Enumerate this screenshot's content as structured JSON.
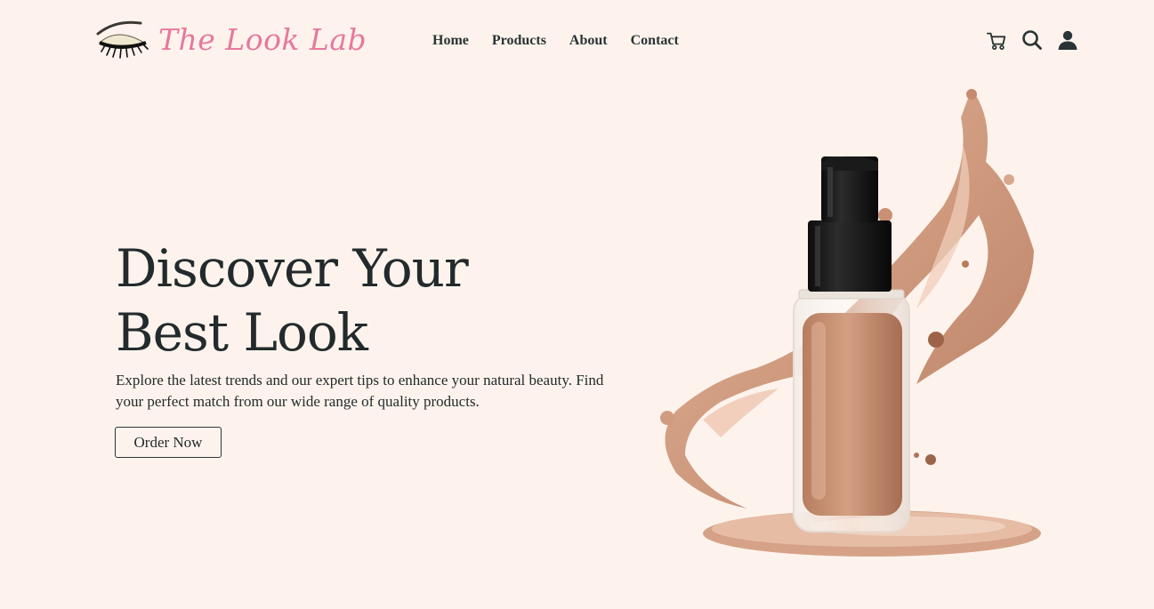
{
  "brand": {
    "name": "The Look Lab",
    "logo_icon": "eye-lashes-icon",
    "accent_color": "#e8779e"
  },
  "nav": {
    "items": [
      {
        "label": "Home"
      },
      {
        "label": "Products"
      },
      {
        "label": "About"
      },
      {
        "label": "Contact"
      }
    ]
  },
  "header_icons": [
    "cart-icon",
    "search-icon",
    "user-icon"
  ],
  "hero": {
    "title_line1": "Discover Your",
    "title_line2": "Best Look",
    "description": "Explore the latest trends and our expert tips to enhance your natural beauty. Find your perfect match from our wide range of quality products.",
    "cta_label": "Order Now",
    "image_subject": "foundation-bottle-splash"
  },
  "colors": {
    "background": "#fdf3ec",
    "text": "#222a2c",
    "foundation": "#c98f72"
  }
}
